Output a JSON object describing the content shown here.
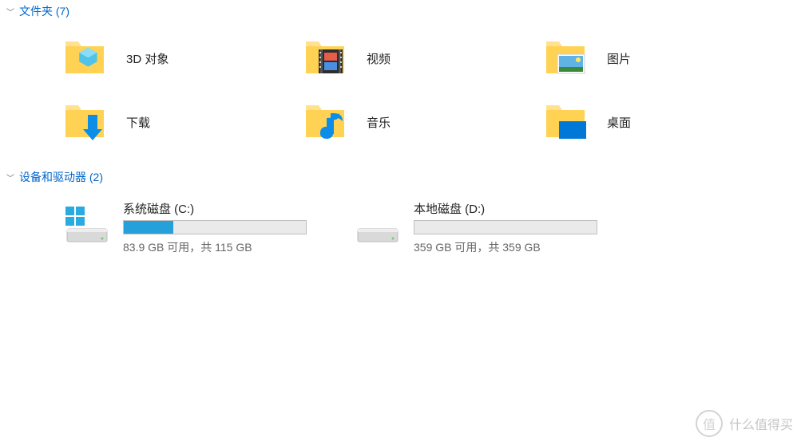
{
  "sections": {
    "folders": {
      "title": "文件夹 (7)",
      "items": [
        {
          "id": "3d-objects",
          "label": "3D 对象"
        },
        {
          "id": "videos",
          "label": "视频"
        },
        {
          "id": "pictures",
          "label": "图片"
        },
        {
          "id": "downloads",
          "label": "下载"
        },
        {
          "id": "music",
          "label": "音乐"
        },
        {
          "id": "desktop",
          "label": "桌面"
        }
      ]
    },
    "drives": {
      "title": "设备和驱动器 (2)",
      "items": [
        {
          "id": "c-drive",
          "name": "系统磁盘 (C:)",
          "free_gb": 83.9,
          "total_gb": 115,
          "stats_text": "83.9 GB 可用，共 115 GB",
          "used_percent": 27,
          "is_system": true
        },
        {
          "id": "d-drive",
          "name": "本地磁盘 (D:)",
          "free_gb": 359,
          "total_gb": 359,
          "stats_text": "359 GB 可用，共 359 GB",
          "used_percent": 0,
          "is_system": false
        }
      ]
    }
  },
  "watermark": {
    "symbol": "值",
    "text": "什么值得买"
  }
}
